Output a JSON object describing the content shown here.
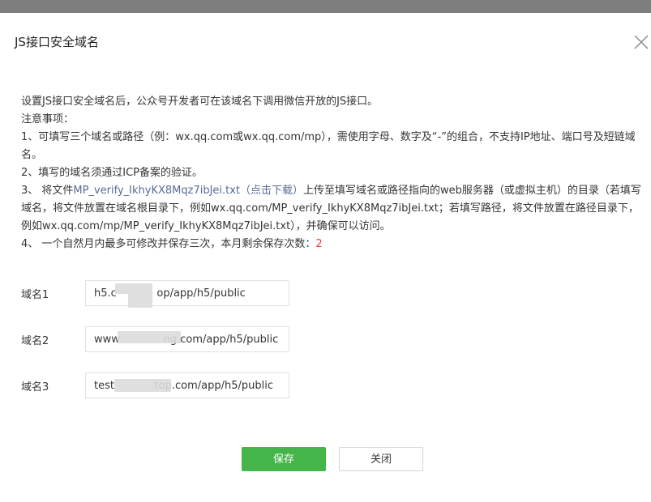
{
  "dialog": {
    "title": "JS接口安全域名",
    "close_icon": "close-icon"
  },
  "notes": {
    "intro": "设置JS接口安全域名后，公众号开发者可在该域名下调用微信开放的JS接口。",
    "heading": "注意事项：",
    "item1": "1、可填写三个域名或路径（例：wx.qq.com或wx.qq.com/mp），需使用字母、数字及“-”的组合，不支持IP地址、端口号及短链域名。",
    "item2": "2、填写的域名须通过ICP备案的验证。",
    "item3_prefix": "3、 将文件",
    "item3_file_link": "MP_verify_IkhyKX8Mqz7ibJei.txt（点击下载）",
    "item3_suffix": "上传至填写域名或路径指向的web服务器（或虚拟主机）的目录（若填写域名，将文件放置在域名根目录下，例如wx.qq.com/MP_verify_IkhyKX8Mqz7ibJei.txt；若填写路径，将文件放置在路径目录下，例如wx.qq.com/mp/MP_verify_IkhyKX8Mqz7ibJei.txt），并确保可以访问。",
    "item4_prefix": "4、 一个自然月内最多可修改并保存三次，本月剩余保存次数：",
    "item4_count": "2",
    "count_color": "#e64340"
  },
  "form": {
    "domain1": {
      "label": "域名1",
      "value": "h5.c            op/app/h5/public"
    },
    "domain2": {
      "label": "域名2",
      "value": "www             ng.com/app/h5/public"
    },
    "domain3": {
      "label": "域名3",
      "value": "test            top.com/app/h5/public"
    }
  },
  "buttons": {
    "save_label": "保存",
    "close_label": "关闭",
    "save_color": "#44b549"
  }
}
